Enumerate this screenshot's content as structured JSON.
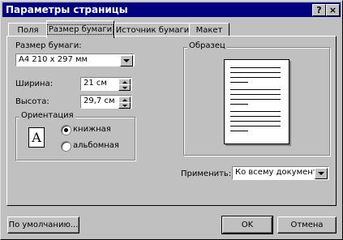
{
  "window": {
    "title": "Параметры страницы",
    "help_label": "?",
    "close_label": "×"
  },
  "tabs": [
    {
      "label": "Поля",
      "active": false
    },
    {
      "label": "Размер бумаги",
      "active": true
    },
    {
      "label": "Источник бумаги",
      "active": false
    },
    {
      "label": "Макет",
      "active": false
    }
  ],
  "paper_size": {
    "label": "Размер бумаги:",
    "value": "A4 210 x 297 мм"
  },
  "width": {
    "label": "Ширина:",
    "value": "21 см"
  },
  "height": {
    "label": "Высота:",
    "value": "29,7 см"
  },
  "orientation": {
    "label": "Ориентация",
    "icon_glyph": "A",
    "portrait_label": "книжная",
    "landscape_label": "альбомная",
    "selected": "portrait"
  },
  "preview": {
    "label": "Образец"
  },
  "apply": {
    "label": "Применить:",
    "value": "Ко всему документу"
  },
  "buttons": {
    "default_label": "По умолчанию...",
    "ok_label": "OK",
    "cancel_label": "Отмена"
  }
}
